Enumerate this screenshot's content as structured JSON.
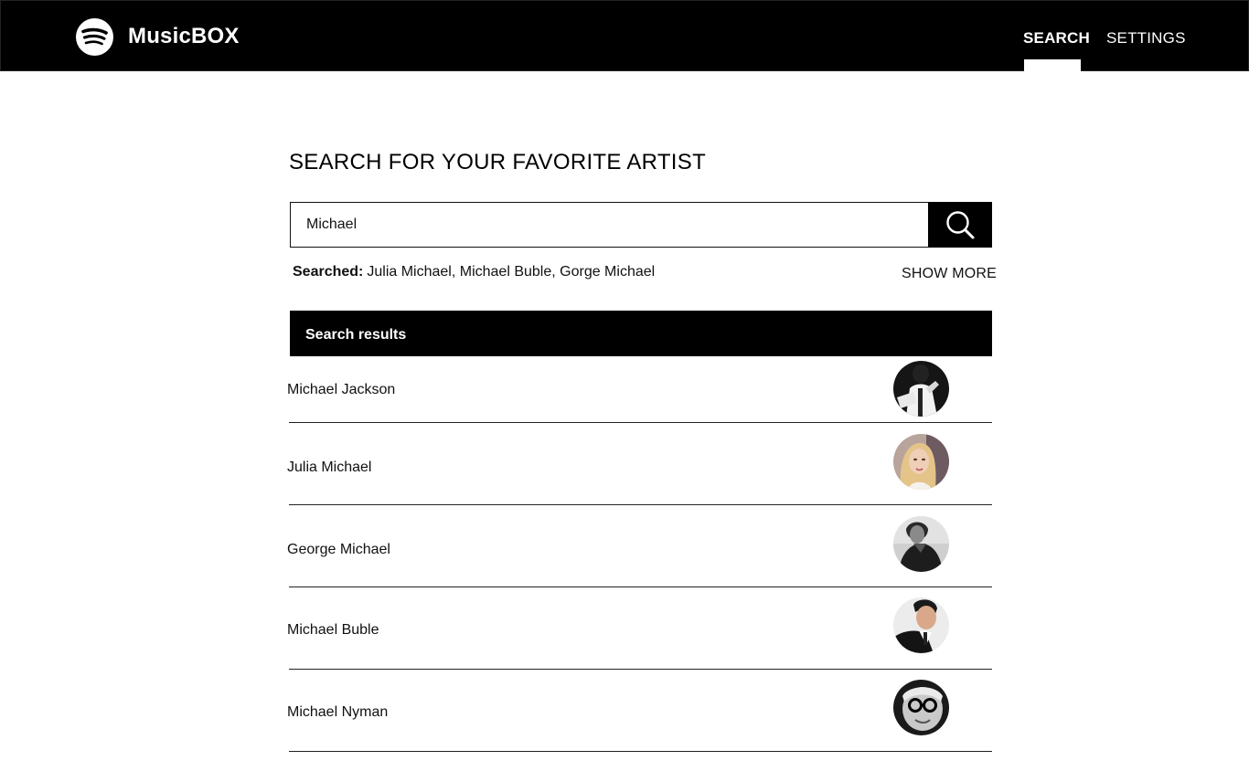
{
  "app": {
    "brand": "MusicBOX",
    "logo_icon": "spotify-icon"
  },
  "nav": {
    "search_label": "SEARCH",
    "settings_label": "SETTINGS",
    "active": "SEARCH"
  },
  "main": {
    "title": "SEARCH FOR YOUR FAVORITE ARTIST",
    "search_value": "Michael",
    "search_icon": "search-icon",
    "searched_label": "Searched:",
    "searched_terms": "Julia Michael, Michael Buble, Gorge Michael",
    "show_more_label": "SHOW MORE",
    "results_header": "Search results",
    "results": [
      {
        "name": "Michael Jackson"
      },
      {
        "name": "Julia Michael"
      },
      {
        "name": "George Michael"
      },
      {
        "name": "Michael Buble"
      },
      {
        "name": "Michael Nyman"
      }
    ]
  },
  "colors": {
    "header_bg": "#000000",
    "accent": "#ffffff",
    "text": "#111111"
  }
}
